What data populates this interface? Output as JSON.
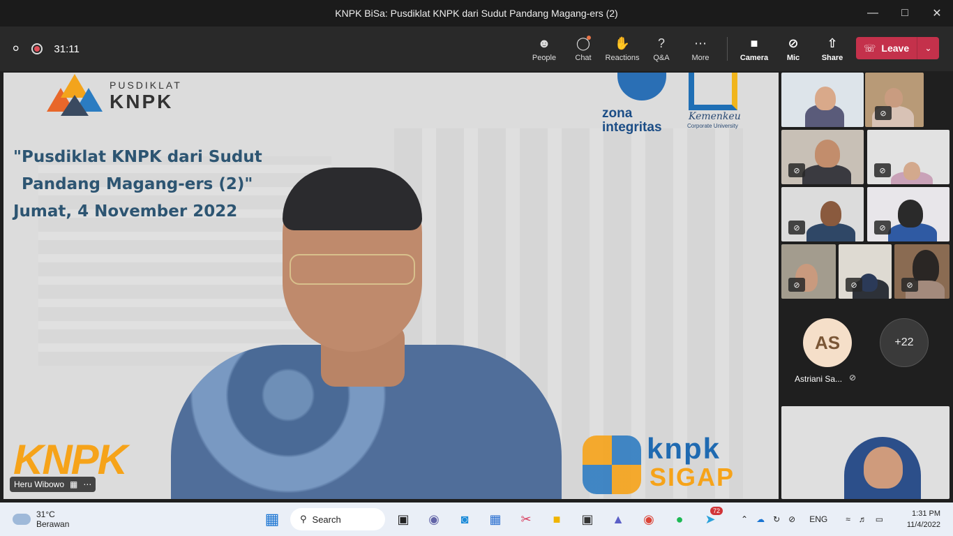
{
  "window": {
    "title": "KNPK BiSa: Pusdiklat KNPK dari Sudut Pandang Magang-ers (2)"
  },
  "meeting": {
    "timer": "31:11",
    "toolbar": [
      {
        "label": "People",
        "icon": "people-icon"
      },
      {
        "label": "Chat",
        "icon": "chat-icon"
      },
      {
        "label": "Reactions",
        "icon": "reactions-icon"
      },
      {
        "label": "Q&A",
        "icon": "qa-icon"
      },
      {
        "label": "More",
        "icon": "more-icon"
      }
    ],
    "media": [
      {
        "label": "Camera",
        "icon": "camera-icon"
      },
      {
        "label": "Mic",
        "icon": "mic-off-icon"
      },
      {
        "label": "Share",
        "icon": "share-icon"
      }
    ],
    "leave_label": "Leave"
  },
  "stage": {
    "logo_small": "PUSDIKLAT",
    "logo_big": "KNPK",
    "headline_lines": [
      "\"Pusdiklat KNPK dari Sudut",
      "Pandang Magang-ers (2)\"",
      "Jumat, 4 November 2022"
    ],
    "zona_1": "zona",
    "zona_2": "integritas",
    "kemenkeu_1": "Kemenkeu",
    "kemenkeu_2": "Corporate University",
    "knpk_orange": "KNPK",
    "sigap_1": "knpk",
    "sigap_2": "SIGAP",
    "speaker_name": "Heru Wibowo"
  },
  "participants": {
    "avatar_initials": "AS",
    "avatar_name": "Astriani Sa...",
    "overflow_count": "+22"
  },
  "taskbar": {
    "weather_temp": "31°C",
    "weather_desc": "Berawan",
    "search_label": "Search",
    "telegram_badge": "72",
    "lang": "ENG",
    "time": "1:31 PM",
    "date": "11/4/2022"
  },
  "colors": {
    "leave": "#c4314b",
    "headline": "#2d5572",
    "brand_orange": "#f6a319",
    "brand_blue": "#1f6ab1"
  }
}
